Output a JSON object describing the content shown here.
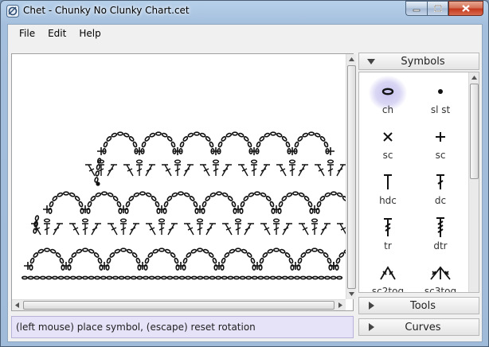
{
  "window": {
    "title": "Chet - Chunky No Clunky Chart.cet"
  },
  "menu": {
    "items": [
      "File",
      "Edit",
      "Help"
    ]
  },
  "status": {
    "text": "(left mouse) place symbol, (escape) reset rotation"
  },
  "panels": {
    "symbols": "Symbols",
    "tools": "Tools",
    "curves": "Curves"
  },
  "symbols": [
    {
      "label": "ch",
      "icon": "chain-icon",
      "selected": true
    },
    {
      "label": "sl st",
      "icon": "slip-stitch-icon",
      "selected": false
    },
    {
      "label": "sc",
      "icon": "single-crochet-x-icon",
      "selected": false
    },
    {
      "label": "sc",
      "icon": "single-crochet-plus-icon",
      "selected": false
    },
    {
      "label": "hdc",
      "icon": "half-double-crochet-icon",
      "selected": false
    },
    {
      "label": "dc",
      "icon": "double-crochet-icon",
      "selected": false
    },
    {
      "label": "tr",
      "icon": "treble-crochet-icon",
      "selected": false
    },
    {
      "label": "dtr",
      "icon": "double-treble-crochet-icon",
      "selected": false
    },
    {
      "label": "sc2tog",
      "icon": "sc2tog-icon",
      "selected": false
    },
    {
      "label": "sc3tog",
      "icon": "sc3tog-icon",
      "selected": false
    }
  ],
  "colors": {
    "selection": "#c7c3ee",
    "status_bg": "#e6e2f8"
  }
}
